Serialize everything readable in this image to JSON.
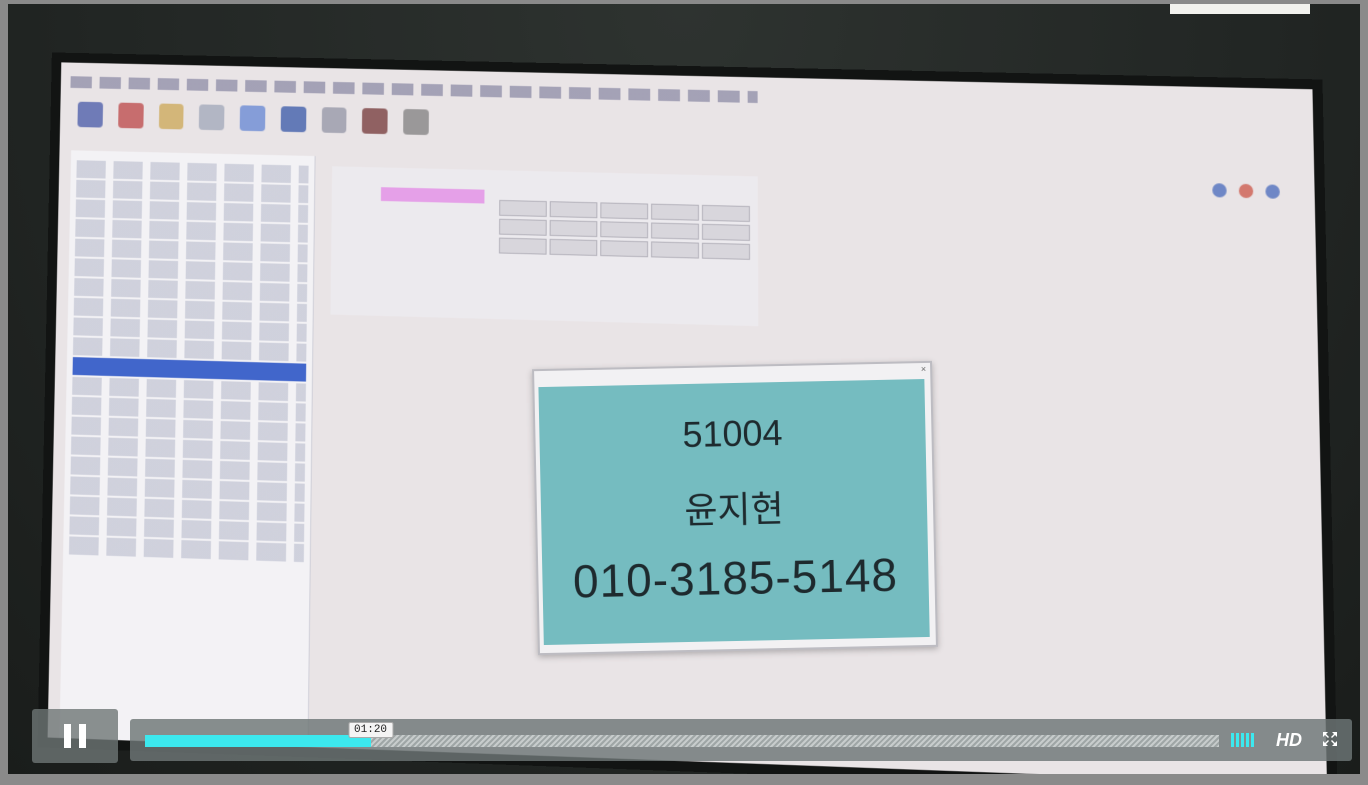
{
  "popup": {
    "id": "51004",
    "name": "윤지현",
    "phone": "010-3185-5148"
  },
  "player": {
    "time_tooltip": "01:20",
    "progress": 0.21,
    "hd_label": "HD",
    "icons": {
      "pause": "pause-icon",
      "volume": "volume-bars-icon",
      "fullscreen": "fullscreen-icon"
    },
    "colors": {
      "progress_fill": "#3ce8ee",
      "popup_background": "#75bcc0"
    }
  }
}
